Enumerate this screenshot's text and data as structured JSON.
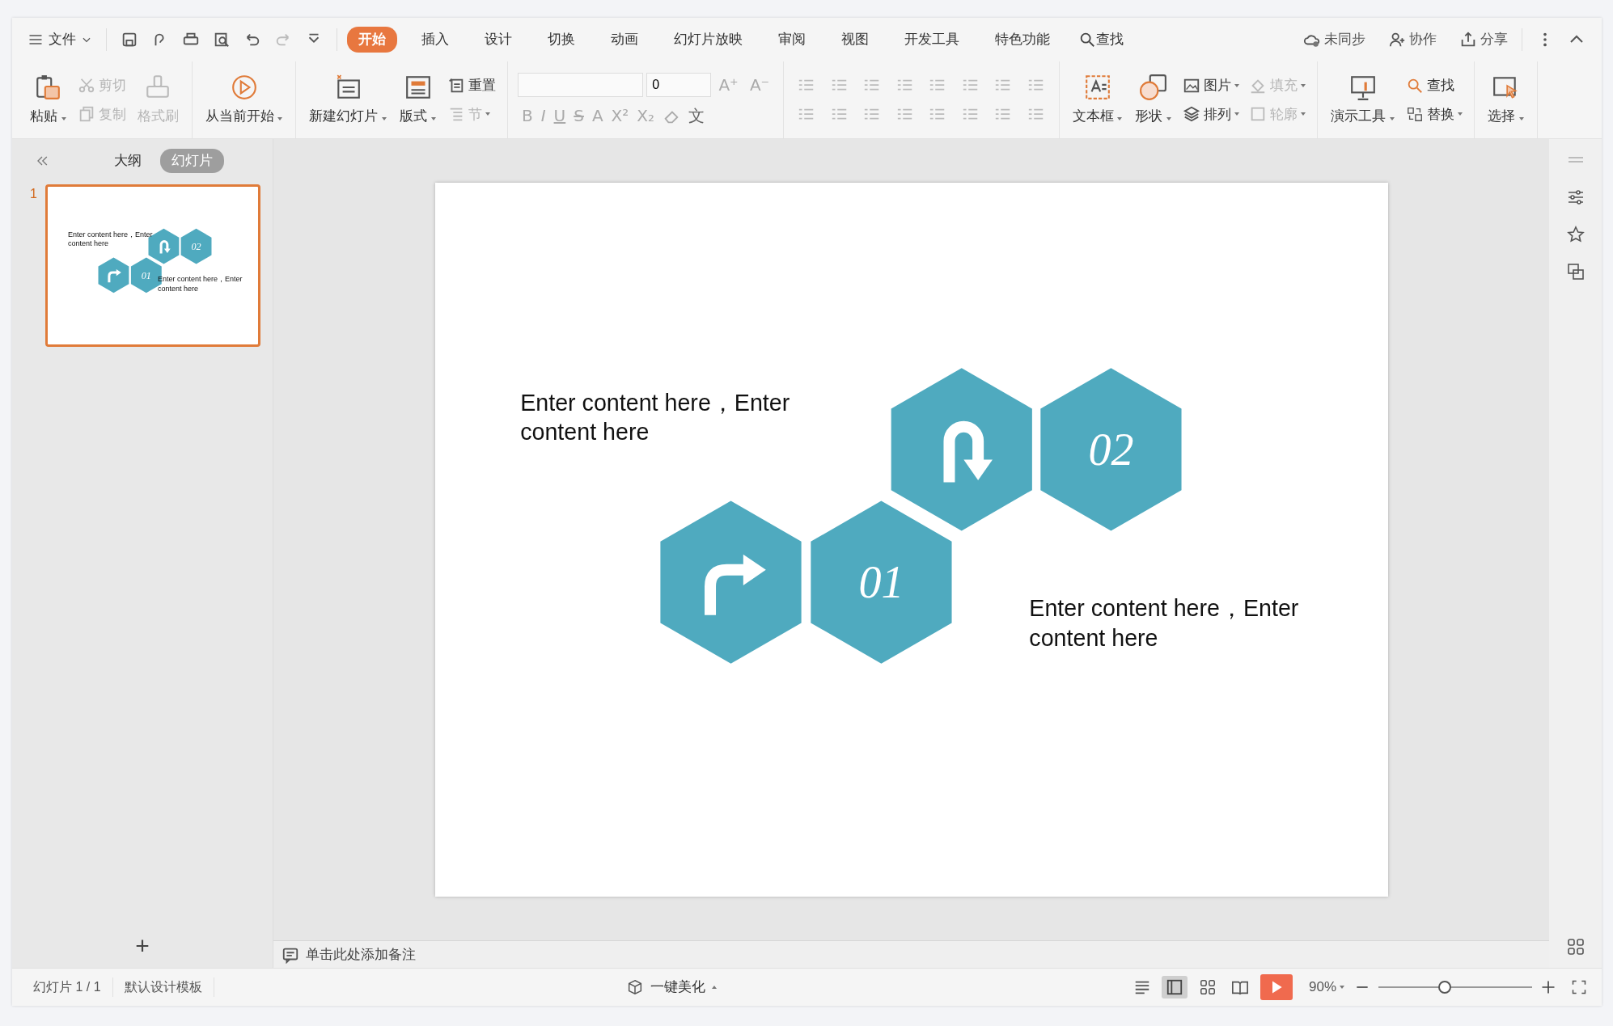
{
  "menu": {
    "file": "文件",
    "tabs": [
      {
        "label": "开始",
        "selected": true
      },
      {
        "label": "插入",
        "selected": false
      },
      {
        "label": "设计",
        "selected": false
      },
      {
        "label": "切换",
        "selected": false
      },
      {
        "label": "动画",
        "selected": false
      },
      {
        "label": "幻灯片放映",
        "selected": false
      },
      {
        "label": "审阅",
        "selected": false
      },
      {
        "label": "视图",
        "selected": false
      },
      {
        "label": "开发工具",
        "selected": false
      },
      {
        "label": "特色功能",
        "selected": false
      }
    ],
    "search": "查找",
    "right": [
      "未同步",
      "协作",
      "分享"
    ]
  },
  "ribbon": {
    "groups": [
      {
        "kind": "tools",
        "tools": [
          {
            "kind": "big",
            "label": "粘贴",
            "caret": true,
            "disabled": false
          },
          {
            "kind": "stack",
            "items": [
              {
                "label": "剪切",
                "caret": false,
                "disabled": true
              },
              {
                "label": "复制",
                "caret": false,
                "disabled": true
              }
            ]
          },
          {
            "kind": "big",
            "label": "格式刷",
            "caret": false,
            "disabled": true
          }
        ]
      },
      {
        "kind": "tools",
        "tools": [
          {
            "kind": "big",
            "label": "从当前开始",
            "caret": true,
            "disabled": false
          }
        ]
      },
      {
        "kind": "tools",
        "tools": [
          {
            "kind": "big",
            "label": "新建幻灯片",
            "caret": true,
            "disabled": false
          },
          {
            "kind": "big",
            "label": "版式",
            "caret": true,
            "disabled": false
          },
          {
            "kind": "stack",
            "items": [
              {
                "label": "重置",
                "caret": false,
                "disabled": false
              },
              {
                "label": "节",
                "caret": true,
                "disabled": true
              }
            ]
          }
        ]
      },
      {
        "kind": "font",
        "size": "0",
        "row1": [
          "A⁺",
          "A⁻"
        ],
        "row2": [
          "B",
          "I",
          "U",
          "S",
          "A",
          "X²",
          "X₂"
        ],
        "phonetic": "文"
      },
      {
        "kind": "paragraph"
      },
      {
        "kind": "tools",
        "tools": [
          {
            "kind": "big",
            "label": "文本框",
            "caret": true,
            "disabled": false
          },
          {
            "kind": "big",
            "label": "形状",
            "caret": true,
            "disabled": false
          },
          {
            "kind": "stack",
            "items": [
              {
                "label": "图片",
                "caret": true,
                "disabled": false
              },
              {
                "label": "排列",
                "caret": true,
                "disabled": false
              }
            ]
          },
          {
            "kind": "stack",
            "items": [
              {
                "label": "填充",
                "caret": true,
                "disabled": true
              },
              {
                "label": "轮廓",
                "caret": true,
                "disabled": true
              }
            ]
          }
        ]
      },
      {
        "kind": "tools",
        "tools": [
          {
            "kind": "big",
            "label": "演示工具",
            "caret": true,
            "disabled": false
          },
          {
            "kind": "stack",
            "items": [
              {
                "label": "查找",
                "caret": false,
                "disabled": false
              },
              {
                "label": "替换",
                "caret": true,
                "disabled": false
              }
            ]
          }
        ]
      },
      {
        "kind": "tools",
        "tools": [
          {
            "kind": "big",
            "label": "选择",
            "caret": true,
            "disabled": false
          }
        ]
      }
    ]
  },
  "panel": {
    "tabs": [
      {
        "label": "大纲",
        "selected": false
      },
      {
        "label": "幻灯片",
        "selected": true
      }
    ],
    "add": "+"
  },
  "thumbnails": [
    {
      "number": "1",
      "selected": true,
      "texts": [
        "Enter content here，Enter content here",
        "Enter content here，Enter content here"
      ],
      "hexagons": [
        {
          "kind": "uturn"
        },
        {
          "kind": "number",
          "label": "02"
        },
        {
          "kind": "turn"
        },
        {
          "kind": "number",
          "label": "01"
        }
      ]
    }
  ],
  "slide": {
    "texts": [
      "Enter content here，Enter content here",
      "Enter content here，Enter content here"
    ],
    "hexagons": [
      {
        "kind": "uturn"
      },
      {
        "kind": "number",
        "label": "02"
      },
      {
        "kind": "turn"
      },
      {
        "kind": "number",
        "label": "01"
      }
    ]
  },
  "notes": {
    "placeholder": "单击此处添加备注"
  },
  "status_bar": {
    "slide": "幻灯片 1 / 1",
    "template": "默认设计模板",
    "beautify": "一键美化",
    "zoom": "90%",
    "zoom_slider": {
      "level": 0.43
    }
  }
}
